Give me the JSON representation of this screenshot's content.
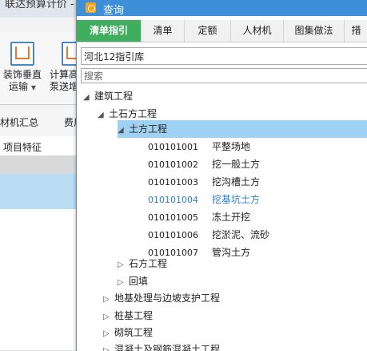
{
  "background_app": {
    "title_fragment": "联达预算计价 -",
    "ribbon": [
      {
        "label_line1": "装饰垂直",
        "label_line2": "运输"
      },
      {
        "label_line1": "计算高",
        "label_line2": "泵送增"
      }
    ],
    "tabs": [
      "材机汇总",
      "费用"
    ],
    "grid_header": "项目特征"
  },
  "dialog": {
    "title": "查询",
    "tabs": [
      {
        "label": "清单指引",
        "active": true
      },
      {
        "label": "清单",
        "active": false
      },
      {
        "label": "定额",
        "active": false
      },
      {
        "label": "人材机",
        "active": false
      },
      {
        "label": "图集做法",
        "active": false
      },
      {
        "label": "措",
        "active": false
      }
    ],
    "library": "河北12指引库",
    "search_placeholder": "搜索",
    "tree": {
      "root": "建筑工程",
      "level1_expanded": "土石方工程",
      "level2_selected": "土方工程",
      "items": [
        {
          "code": "010101001",
          "name": "平整场地"
        },
        {
          "code": "010101002",
          "name": "挖一般土方"
        },
        {
          "code": "010101003",
          "name": "挖沟槽土方"
        },
        {
          "code": "010101004",
          "name": "挖基坑土方",
          "highlight": true
        },
        {
          "code": "010101005",
          "name": "冻土开挖"
        },
        {
          "code": "010101006",
          "name": "挖淤泥、流砂"
        },
        {
          "code": "010101007",
          "name": "管沟土方"
        }
      ],
      "level2_collapsed": [
        "石方工程",
        "回填"
      ],
      "level1_collapsed": [
        "地基处理与边坡支护工程",
        "桩基工程",
        "砌筑工程",
        "混凝土及钢筋混凝土工程"
      ]
    }
  }
}
